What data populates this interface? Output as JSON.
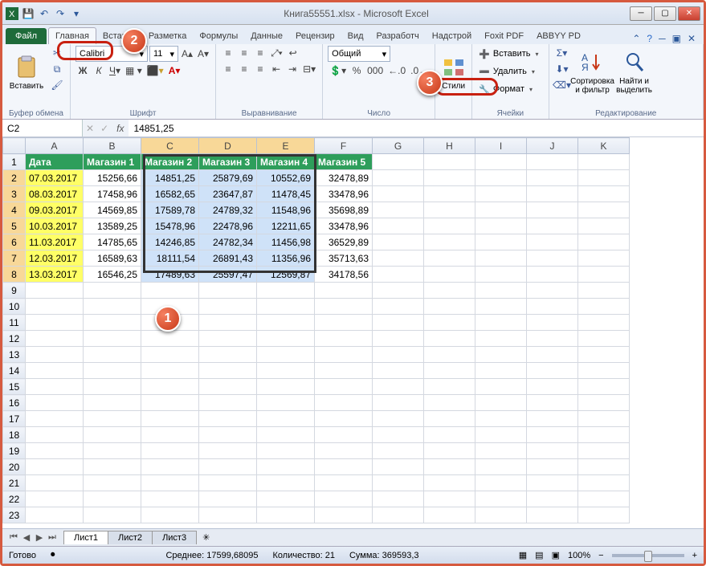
{
  "title": "Книга55551.xlsx - Microsoft Excel",
  "qat": {
    "save": "💾",
    "undo": "↶",
    "redo": "↷"
  },
  "tabs": {
    "file": "Файл",
    "items": [
      "Главная",
      "Вставка",
      "Разметка",
      "Формулы",
      "Данные",
      "Рецензир",
      "Вид",
      "Разработч",
      "Надстрой",
      "Foxit PDF",
      "ABBYY PD"
    ],
    "active_index": 0
  },
  "ribbon": {
    "clipboard": {
      "paste": "Вставить",
      "label": "Буфер обмена"
    },
    "font": {
      "name": "Calibri",
      "size": "11",
      "label": "Шрифт"
    },
    "alignment": {
      "label": "Выравнивание"
    },
    "number": {
      "format": "Общий",
      "label": "Число"
    },
    "styles": {
      "btn": "Стили",
      "label": ""
    },
    "cells": {
      "insert": "Вставить",
      "delete": "Удалить",
      "format": "Формат",
      "label": "Ячейки"
    },
    "editing": {
      "sort": "Сортировка\nи фильтр",
      "find": "Найти и\nвыделить",
      "label": "Редактирование"
    }
  },
  "namebox": "C2",
  "formula": "14851,25",
  "columns": [
    "A",
    "B",
    "C",
    "D",
    "E",
    "F",
    "G",
    "H",
    "I",
    "J",
    "K"
  ],
  "header_row": [
    "Дата",
    "Магазин 1",
    "Магазин 2",
    "Магазин 3",
    "Магазин 4",
    "Магазин 5"
  ],
  "data_rows": [
    [
      "07.03.2017",
      "15256,66",
      "14851,25",
      "25879,69",
      "10552,69",
      "32478,89"
    ],
    [
      "08.03.2017",
      "17458,96",
      "16582,65",
      "23647,87",
      "11478,45",
      "33478,96"
    ],
    [
      "09.03.2017",
      "14569,85",
      "17589,78",
      "24789,32",
      "11548,96",
      "35698,89"
    ],
    [
      "10.03.2017",
      "13589,25",
      "15478,96",
      "22478,96",
      "12211,65",
      "33478,96"
    ],
    [
      "11.03.2017",
      "14785,65",
      "14246,85",
      "24782,34",
      "11456,98",
      "36529,89"
    ],
    [
      "12.03.2017",
      "16589,63",
      "18111,54",
      "26891,43",
      "11356,96",
      "35713,63"
    ],
    [
      "13.03.2017",
      "16546,25",
      "17489,63",
      "25597,47",
      "12569,87",
      "34178,56"
    ]
  ],
  "sheets": [
    "Лист1",
    "Лист2",
    "Лист3"
  ],
  "active_sheet": 0,
  "status": {
    "ready": "Готово",
    "avg_label": "Среднее:",
    "avg": "17599,68095",
    "count_label": "Количество:",
    "count": "21",
    "sum_label": "Сумма:",
    "sum": "369593,3",
    "zoom": "100%"
  },
  "callouts": {
    "c1": "1",
    "c2": "2",
    "c3": "3"
  }
}
